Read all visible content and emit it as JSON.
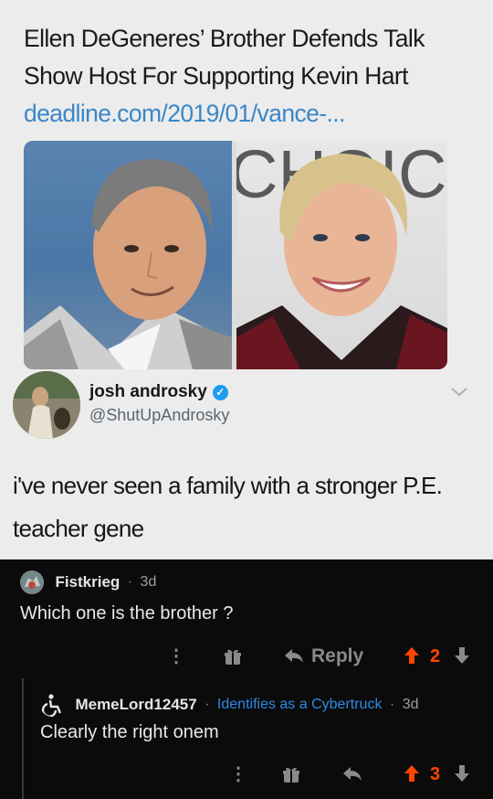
{
  "tweet": {
    "headline_text": "Ellen DeGeneres’ Brother Defends Talk Show Host For Supporting Kevin Hart",
    "headline_link": "deadline.com/2019/01/vance-...",
    "backdrop_letters": "CHOIC ARD",
    "author_name": "josh androsky",
    "author_handle": "@ShutUpAndrosky",
    "text": "i've never seen a family with a stronger P.E. teacher gene"
  },
  "comment": {
    "username": "Fistkrieg",
    "separator": "·",
    "age": "3d",
    "body": "Which one is the brother ?",
    "reply_label": "Reply",
    "votes": "2"
  },
  "reply": {
    "username": "MemeLord12457",
    "separator": "·",
    "flair": "Identifies as a Cybertruck",
    "age": "3d",
    "body": "Clearly the right onem",
    "votes": "3"
  },
  "icons": {
    "more": "more-vertical-icon",
    "award": "gift-award-icon",
    "reply": "reply-arrow-icon",
    "upvote": "upvote-arrow-icon",
    "downvote": "downvote-arrow-icon",
    "verified": "verified-badge-icon",
    "accessibility": "wheelchair-icon"
  },
  "colors": {
    "upvoted": "#ff4500",
    "flair": "#2f8ae6",
    "link": "#3a87c8",
    "verified": "#1d9bf0",
    "dark_bg": "#0b0b0b",
    "tweet_bg": "#ececec"
  }
}
